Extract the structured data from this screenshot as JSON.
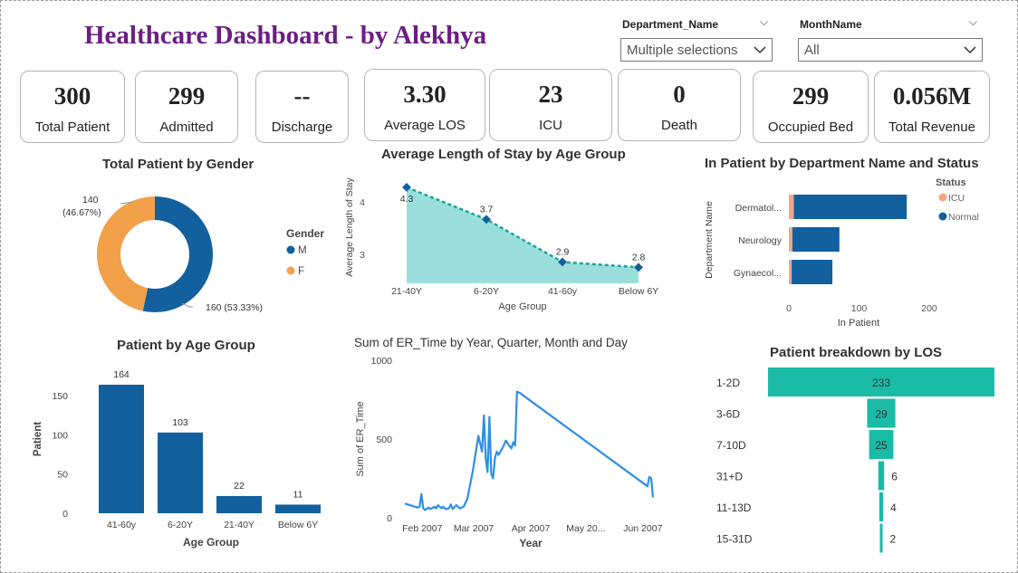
{
  "title": "Healthcare Dashboard - by Alekhya",
  "slicers": {
    "department": {
      "label": "Department_Name",
      "value": "Multiple selections"
    },
    "month": {
      "label": "MonthName",
      "value": "All"
    }
  },
  "kpis": [
    {
      "value": "300",
      "label": "Total Patient"
    },
    {
      "value": "299",
      "label": "Admitted"
    },
    {
      "value": "--",
      "label": "Discharge"
    },
    {
      "value": "3.30",
      "label": "Average LOS"
    },
    {
      "value": "23",
      "label": "ICU"
    },
    {
      "value": "0",
      "label": "Death"
    },
    {
      "value": "299",
      "label": "Occupied Bed"
    },
    {
      "value": "0.056M",
      "label": "Total Revenue"
    }
  ],
  "colors": {
    "primary": "#12609E",
    "orange": "#F2A04A",
    "teal": "#1ABBA7",
    "teal_area": "#9ADFDC",
    "teal_line": "#1AA59C",
    "er_line": "#2E8EE8",
    "icu": "#F4A58A",
    "title": "#6B1E83"
  },
  "chart_data": [
    {
      "type": "pie",
      "title": "Total Patient by Gender",
      "legend_title": "Gender",
      "labels": [
        "M",
        "F"
      ],
      "values": [
        160,
        140
      ],
      "data_labels": [
        "160 (53.33%)",
        "140",
        "(46.67%)"
      ]
    },
    {
      "type": "area",
      "title": "Average Length of Stay by Age Group",
      "categories": [
        "21-40Y",
        "6-20Y",
        "41-60y",
        "Below 6Y"
      ],
      "values": [
        4.3,
        3.7,
        2.9,
        2.8
      ],
      "data_labels": [
        "4.3",
        "3.7",
        "2.9",
        "2.8"
      ],
      "xlabel": "Age Group",
      "ylabel": "Average Length of Stay",
      "yticks": [
        "3",
        "4"
      ],
      "ylim": [
        2.5,
        4.4
      ]
    },
    {
      "type": "bar",
      "orientation": "horizontal",
      "stacked": true,
      "title": "In Patient by Department Name and Status",
      "categories": [
        "Dermatol...",
        "Neurology",
        "Gynaecol..."
      ],
      "legend_title": "Status",
      "series": [
        {
          "name": "ICU",
          "values": [
            7,
            5,
            4
          ]
        },
        {
          "name": "Normal",
          "values": [
            161,
            67,
            58
          ]
        }
      ],
      "xlabel": "In Patient",
      "ylabel": "Department Name",
      "xticks": [
        "0",
        "100",
        "200"
      ],
      "xlim": [
        0,
        200
      ]
    },
    {
      "type": "bar",
      "title": "Patient by Age Group",
      "categories": [
        "41-60y",
        "6-20Y",
        "21-40Y",
        "Below 6Y"
      ],
      "values": [
        164,
        103,
        22,
        11
      ],
      "data_labels": [
        "164",
        "103",
        "22",
        "11"
      ],
      "xlabel": "Age Group",
      "ylabel": "Patient",
      "yticks": [
        "0",
        "50",
        "100",
        "150"
      ],
      "ylim": [
        0,
        175
      ]
    },
    {
      "type": "line",
      "title": "Sum of ER_Time by Year, Quarter, Month and Day",
      "xlabel": "Year",
      "ylabel": "Sum of ER_Time",
      "xticks": [
        "Feb 2007",
        "Mar 2007",
        "Apr 2007",
        "May 20...",
        "Jun 2007"
      ],
      "yticks": [
        "0",
        "500",
        "1000"
      ],
      "ylim": [
        0,
        1000
      ],
      "x": [
        "2007-01-23",
        "2007-01-30",
        "2007-01-31",
        "2007-02-01",
        "2007-02-02",
        "2007-02-03",
        "2007-02-05",
        "2007-02-06",
        "2007-02-08",
        "2007-02-09",
        "2007-02-10",
        "2007-02-12",
        "2007-02-13",
        "2007-02-14",
        "2007-02-16",
        "2007-02-17",
        "2007-02-18",
        "2007-02-20",
        "2007-02-22",
        "2007-02-24",
        "2007-02-26",
        "2007-03-01",
        "2007-03-04",
        "2007-03-06",
        "2007-03-07",
        "2007-03-08",
        "2007-03-09",
        "2007-03-10",
        "2007-03-11",
        "2007-03-12",
        "2007-03-13",
        "2007-03-14",
        "2007-03-15",
        "2007-03-17",
        "2007-03-19",
        "2007-03-20",
        "2007-03-22",
        "2007-03-23",
        "2007-03-24",
        "2007-03-25",
        "2007-03-27",
        "2007-03-28",
        "2007-06-04",
        "2007-06-05",
        "2007-06-06",
        "2007-06-07"
      ],
      "values": [
        90,
        65,
        70,
        150,
        60,
        50,
        65,
        55,
        70,
        60,
        80,
        60,
        70,
        55,
        60,
        85,
        55,
        80,
        60,
        70,
        120,
        300,
        520,
        420,
        650,
        380,
        290,
        640,
        280,
        250,
        380,
        420,
        400,
        440,
        490,
        470,
        440,
        480,
        460,
        800,
        790,
        780,
        200,
        260,
        250,
        130
      ]
    },
    {
      "type": "bar",
      "subtype": "funnel",
      "title": "Patient breakdown by LOS",
      "categories": [
        "1-2D",
        "3-6D",
        "7-10D",
        "31+D",
        "11-13D",
        "15-31D"
      ],
      "values": [
        233,
        29,
        25,
        6,
        4,
        2
      ],
      "data_labels": [
        "233",
        "29",
        "25",
        "6",
        "4",
        "2"
      ]
    }
  ]
}
